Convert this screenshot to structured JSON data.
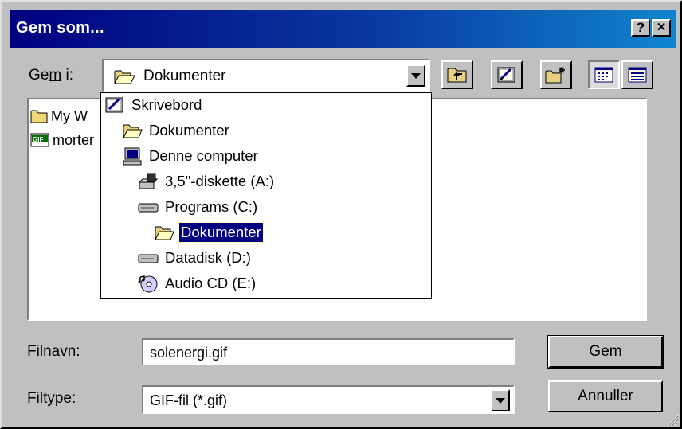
{
  "window": {
    "title": "Gem som...",
    "help_label": "?",
    "close_label": "✕"
  },
  "location": {
    "label_pre": "Ge",
    "label_mnemonic": "m",
    "label_post": " i:",
    "current": "Dokumenter"
  },
  "toolbar": {
    "buttons": [
      {
        "name": "up-one-level",
        "icon": "folder-up-icon"
      },
      {
        "name": "desktop",
        "icon": "desktop-icon"
      },
      {
        "name": "new-folder",
        "icon": "new-folder-icon"
      },
      {
        "name": "list-view",
        "icon": "list-view-icon"
      },
      {
        "name": "details-view",
        "icon": "details-view-icon"
      }
    ]
  },
  "files": [
    {
      "label": "My W",
      "icon": "folder-icon"
    },
    {
      "label": "morter",
      "icon": "gif-file-icon"
    }
  ],
  "dropdown": {
    "items": [
      {
        "label": "Skrivebord",
        "icon": "desktop-icon",
        "indent": 0
      },
      {
        "label": "Dokumenter",
        "icon": "open-folder-icon",
        "indent": 1
      },
      {
        "label": "Denne computer",
        "icon": "computer-icon",
        "indent": 1
      },
      {
        "label": "3,5\"-diskette (A:)",
        "icon": "floppy-drive-icon",
        "indent": 2
      },
      {
        "label": "Programs (C:)",
        "icon": "hard-drive-icon",
        "indent": 2
      },
      {
        "label": "Dokumenter",
        "icon": "open-folder-icon",
        "indent": 3,
        "selected": true
      },
      {
        "label": "Datadisk (D:)",
        "icon": "hard-drive-icon",
        "indent": 2
      },
      {
        "label": "Audio CD (E:)",
        "icon": "audio-cd-icon",
        "indent": 2
      }
    ]
  },
  "filename": {
    "label_pre": "Fil",
    "label_mnemonic": "n",
    "label_post": "avn:",
    "value": "solenergi.gif"
  },
  "filetype": {
    "label_pre": "Fil",
    "label_mnemonic": "t",
    "label_post": "ype:",
    "value": "GIF-fil (*.gif)"
  },
  "buttons": {
    "save_mnemonic": "G",
    "save_rest": "em",
    "cancel": "Annuller"
  }
}
